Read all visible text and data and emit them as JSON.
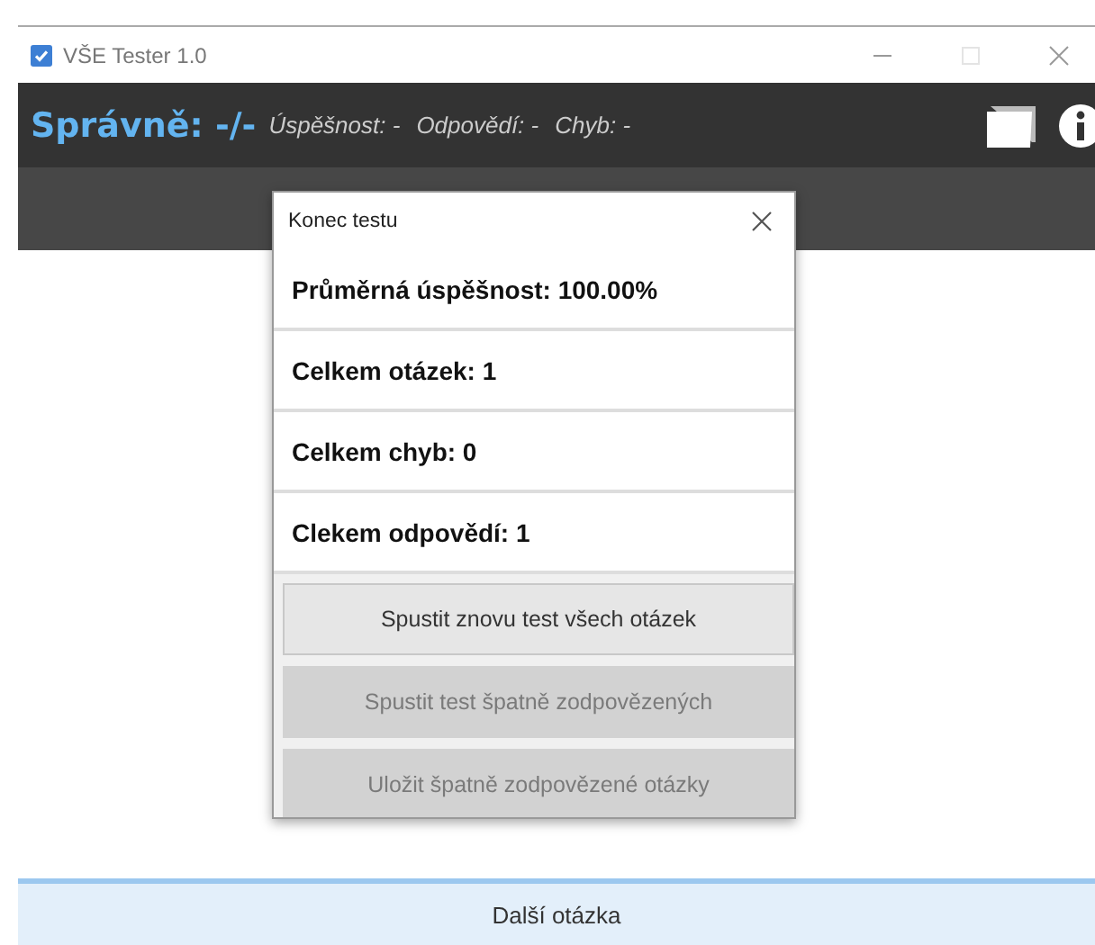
{
  "window": {
    "title": "VŠE Tester 1.0",
    "maximize_disabled": true
  },
  "header": {
    "score_label": "Správně: -/-",
    "stats": [
      "Úspěšnost: -",
      "Odpovědí: -",
      "Chyb: -"
    ]
  },
  "dialog": {
    "title": "Konec testu",
    "stats": [
      "Průměrná úspěšnost: 100.00%",
      "Celkem otázek: 1",
      "Celkem chyb: 0",
      "Clekem odpovědí: 1"
    ],
    "buttons": [
      {
        "label": "Spustit znovu test všech otázek",
        "disabled": false
      },
      {
        "label": "Spustit test špatně zodpovězených",
        "disabled": true
      },
      {
        "label": "Uložit špatně zodpovězené otázky",
        "disabled": true
      }
    ]
  },
  "next_button": {
    "label": "Další otázka"
  }
}
